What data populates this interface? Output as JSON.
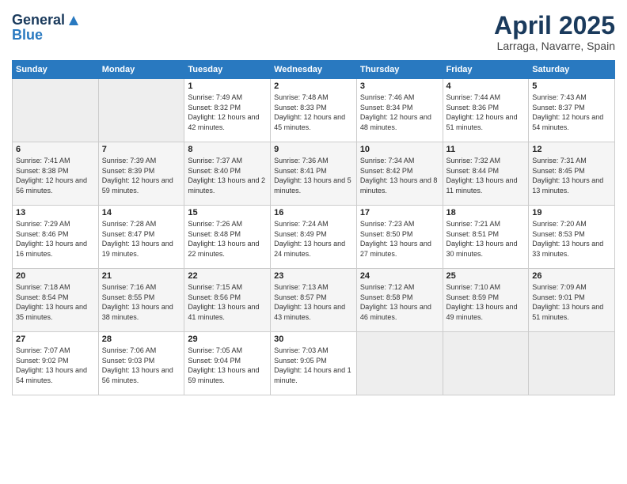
{
  "logo": {
    "line1": "General",
    "line2": "Blue"
  },
  "title": "April 2025",
  "subtitle": "Larraga, Navarre, Spain",
  "days_of_week": [
    "Sunday",
    "Monday",
    "Tuesday",
    "Wednesday",
    "Thursday",
    "Friday",
    "Saturday"
  ],
  "weeks": [
    [
      {
        "day": "",
        "sunrise": "",
        "sunset": "",
        "daylight": ""
      },
      {
        "day": "",
        "sunrise": "",
        "sunset": "",
        "daylight": ""
      },
      {
        "day": "1",
        "sunrise": "Sunrise: 7:49 AM",
        "sunset": "Sunset: 8:32 PM",
        "daylight": "Daylight: 12 hours and 42 minutes."
      },
      {
        "day": "2",
        "sunrise": "Sunrise: 7:48 AM",
        "sunset": "Sunset: 8:33 PM",
        "daylight": "Daylight: 12 hours and 45 minutes."
      },
      {
        "day": "3",
        "sunrise": "Sunrise: 7:46 AM",
        "sunset": "Sunset: 8:34 PM",
        "daylight": "Daylight: 12 hours and 48 minutes."
      },
      {
        "day": "4",
        "sunrise": "Sunrise: 7:44 AM",
        "sunset": "Sunset: 8:36 PM",
        "daylight": "Daylight: 12 hours and 51 minutes."
      },
      {
        "day": "5",
        "sunrise": "Sunrise: 7:43 AM",
        "sunset": "Sunset: 8:37 PM",
        "daylight": "Daylight: 12 hours and 54 minutes."
      }
    ],
    [
      {
        "day": "6",
        "sunrise": "Sunrise: 7:41 AM",
        "sunset": "Sunset: 8:38 PM",
        "daylight": "Daylight: 12 hours and 56 minutes."
      },
      {
        "day": "7",
        "sunrise": "Sunrise: 7:39 AM",
        "sunset": "Sunset: 8:39 PM",
        "daylight": "Daylight: 12 hours and 59 minutes."
      },
      {
        "day": "8",
        "sunrise": "Sunrise: 7:37 AM",
        "sunset": "Sunset: 8:40 PM",
        "daylight": "Daylight: 13 hours and 2 minutes."
      },
      {
        "day": "9",
        "sunrise": "Sunrise: 7:36 AM",
        "sunset": "Sunset: 8:41 PM",
        "daylight": "Daylight: 13 hours and 5 minutes."
      },
      {
        "day": "10",
        "sunrise": "Sunrise: 7:34 AM",
        "sunset": "Sunset: 8:42 PM",
        "daylight": "Daylight: 13 hours and 8 minutes."
      },
      {
        "day": "11",
        "sunrise": "Sunrise: 7:32 AM",
        "sunset": "Sunset: 8:44 PM",
        "daylight": "Daylight: 13 hours and 11 minutes."
      },
      {
        "day": "12",
        "sunrise": "Sunrise: 7:31 AM",
        "sunset": "Sunset: 8:45 PM",
        "daylight": "Daylight: 13 hours and 13 minutes."
      }
    ],
    [
      {
        "day": "13",
        "sunrise": "Sunrise: 7:29 AM",
        "sunset": "Sunset: 8:46 PM",
        "daylight": "Daylight: 13 hours and 16 minutes."
      },
      {
        "day": "14",
        "sunrise": "Sunrise: 7:28 AM",
        "sunset": "Sunset: 8:47 PM",
        "daylight": "Daylight: 13 hours and 19 minutes."
      },
      {
        "day": "15",
        "sunrise": "Sunrise: 7:26 AM",
        "sunset": "Sunset: 8:48 PM",
        "daylight": "Daylight: 13 hours and 22 minutes."
      },
      {
        "day": "16",
        "sunrise": "Sunrise: 7:24 AM",
        "sunset": "Sunset: 8:49 PM",
        "daylight": "Daylight: 13 hours and 24 minutes."
      },
      {
        "day": "17",
        "sunrise": "Sunrise: 7:23 AM",
        "sunset": "Sunset: 8:50 PM",
        "daylight": "Daylight: 13 hours and 27 minutes."
      },
      {
        "day": "18",
        "sunrise": "Sunrise: 7:21 AM",
        "sunset": "Sunset: 8:51 PM",
        "daylight": "Daylight: 13 hours and 30 minutes."
      },
      {
        "day": "19",
        "sunrise": "Sunrise: 7:20 AM",
        "sunset": "Sunset: 8:53 PM",
        "daylight": "Daylight: 13 hours and 33 minutes."
      }
    ],
    [
      {
        "day": "20",
        "sunrise": "Sunrise: 7:18 AM",
        "sunset": "Sunset: 8:54 PM",
        "daylight": "Daylight: 13 hours and 35 minutes."
      },
      {
        "day": "21",
        "sunrise": "Sunrise: 7:16 AM",
        "sunset": "Sunset: 8:55 PM",
        "daylight": "Daylight: 13 hours and 38 minutes."
      },
      {
        "day": "22",
        "sunrise": "Sunrise: 7:15 AM",
        "sunset": "Sunset: 8:56 PM",
        "daylight": "Daylight: 13 hours and 41 minutes."
      },
      {
        "day": "23",
        "sunrise": "Sunrise: 7:13 AM",
        "sunset": "Sunset: 8:57 PM",
        "daylight": "Daylight: 13 hours and 43 minutes."
      },
      {
        "day": "24",
        "sunrise": "Sunrise: 7:12 AM",
        "sunset": "Sunset: 8:58 PM",
        "daylight": "Daylight: 13 hours and 46 minutes."
      },
      {
        "day": "25",
        "sunrise": "Sunrise: 7:10 AM",
        "sunset": "Sunset: 8:59 PM",
        "daylight": "Daylight: 13 hours and 49 minutes."
      },
      {
        "day": "26",
        "sunrise": "Sunrise: 7:09 AM",
        "sunset": "Sunset: 9:01 PM",
        "daylight": "Daylight: 13 hours and 51 minutes."
      }
    ],
    [
      {
        "day": "27",
        "sunrise": "Sunrise: 7:07 AM",
        "sunset": "Sunset: 9:02 PM",
        "daylight": "Daylight: 13 hours and 54 minutes."
      },
      {
        "day": "28",
        "sunrise": "Sunrise: 7:06 AM",
        "sunset": "Sunset: 9:03 PM",
        "daylight": "Daylight: 13 hours and 56 minutes."
      },
      {
        "day": "29",
        "sunrise": "Sunrise: 7:05 AM",
        "sunset": "Sunset: 9:04 PM",
        "daylight": "Daylight: 13 hours and 59 minutes."
      },
      {
        "day": "30",
        "sunrise": "Sunrise: 7:03 AM",
        "sunset": "Sunset: 9:05 PM",
        "daylight": "Daylight: 14 hours and 1 minute."
      },
      {
        "day": "",
        "sunrise": "",
        "sunset": "",
        "daylight": ""
      },
      {
        "day": "",
        "sunrise": "",
        "sunset": "",
        "daylight": ""
      },
      {
        "day": "",
        "sunrise": "",
        "sunset": "",
        "daylight": ""
      }
    ]
  ]
}
